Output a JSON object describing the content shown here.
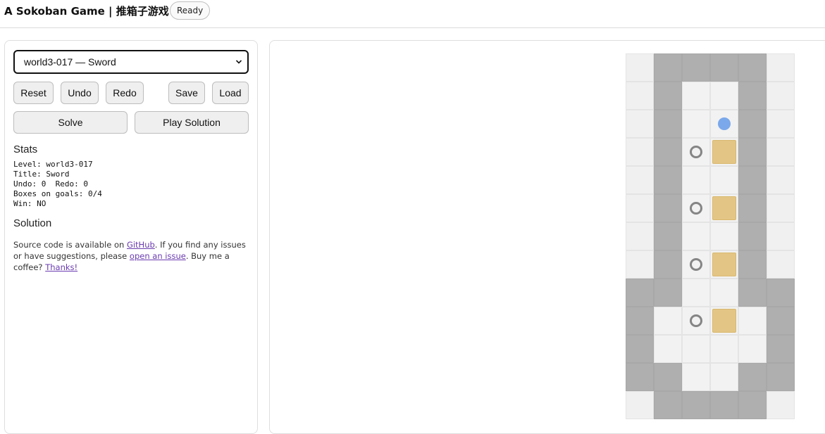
{
  "header": {
    "title": "A Sokoban Game | 推箱子游戏",
    "status": "Ready"
  },
  "controls": {
    "level_select_value": "world3-017 — Sword",
    "buttons": {
      "reset": "Reset",
      "undo": "Undo",
      "redo": "Redo",
      "save": "Save",
      "load": "Load",
      "solve": "Solve",
      "play_solution": "Play Solution"
    }
  },
  "stats": {
    "heading": "Stats",
    "text": "Level: world3-017\nTitle: Sword\nUndo: 0  Redo: 0\nBoxes on goals: 0/4\nWin: NO"
  },
  "solution": {
    "heading": "Solution"
  },
  "footer": {
    "text_1": "Source code is available on ",
    "github_link": "GitHub",
    "text_2": ". If you find any issues or have suggestions, please ",
    "issue_link": "open an issue",
    "text_3": ". Buy me a coffee? ",
    "thanks_link": "Thanks!"
  },
  "colors": {
    "wall": "#afafaf",
    "floor": "#f2f2f2",
    "box": "#e3c585",
    "goal": "#858585",
    "player": "#7aa8ea"
  },
  "level": {
    "legend": "#=wall  space=floor  _=outside  .=goal  $=box  @=player",
    "rows": [
      "_####_",
      "_#  #_",
      "_# @#_",
      "_#.$#_",
      "_#  #_",
      "_#.$#_",
      "_#  #_",
      "_#.$#_",
      "##  ##",
      "# .$ #",
      "#    #",
      "##  ##",
      "_####_"
    ]
  }
}
